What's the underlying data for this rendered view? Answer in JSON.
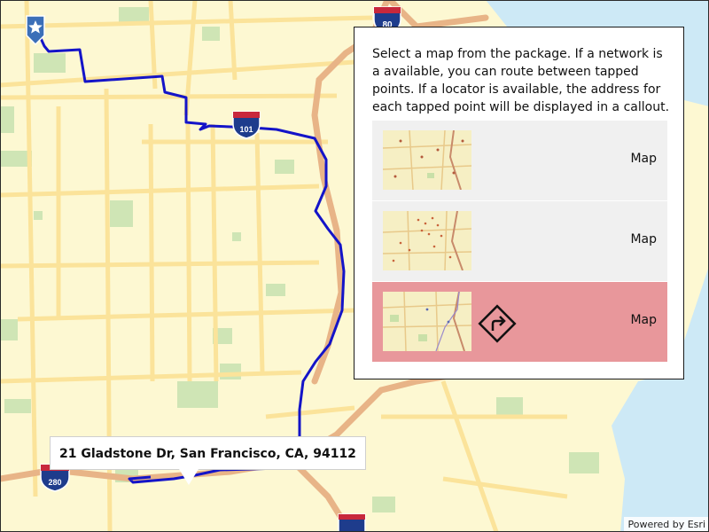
{
  "panel": {
    "instructions": "Select a map from the package. If a network is a available, you can route between tapped points. If a locator is available, the address for each tapped point will be displayed in a callout.",
    "maps": [
      {
        "label": "Map",
        "has_network_icon": false,
        "selected": false
      },
      {
        "label": "Map",
        "has_network_icon": false,
        "selected": false
      },
      {
        "label": "Map",
        "has_network_icon": true,
        "selected": true
      }
    ]
  },
  "callout": {
    "address": "21 Gladstone Dr, San Francisco, CA, 94112"
  },
  "map": {
    "shields": [
      "80",
      "101",
      "280"
    ],
    "start_marker": "star-pin-icon",
    "route_color": "#1414c8",
    "land_color": "#fdf8d2",
    "water_color": "#cde9f6",
    "highway_color": "#e6a678",
    "park_color": "#cfe5b5"
  },
  "attribution": "Powered by Esri",
  "colors": {
    "selected_item": "#e8979b",
    "item_bg": "#f0f0f0"
  }
}
